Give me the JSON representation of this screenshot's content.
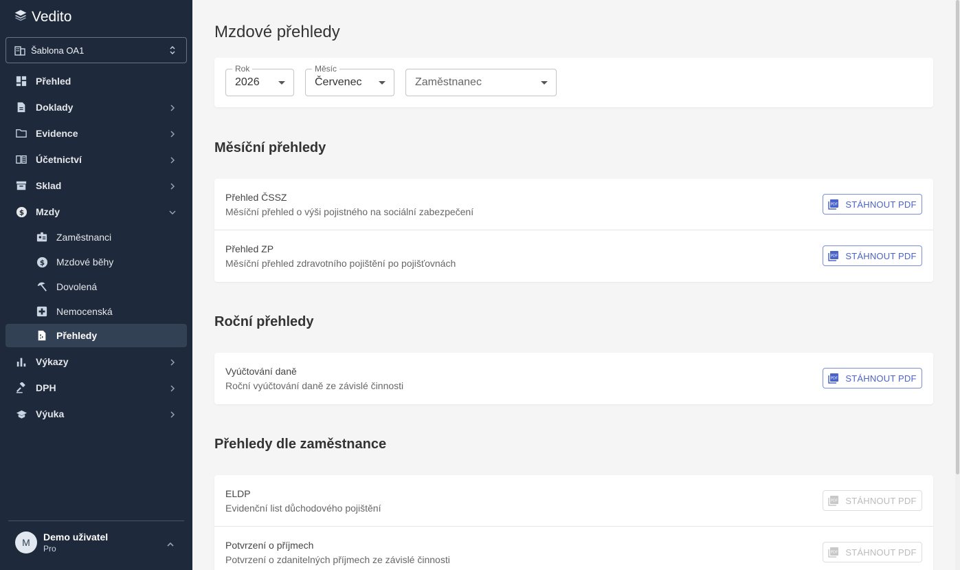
{
  "app": {
    "name": "Vedito"
  },
  "sidebar": {
    "org_select": {
      "value": "Šablona OA1"
    },
    "nav": [
      {
        "label": "Přehled",
        "icon": "dashboard-icon"
      },
      {
        "label": "Doklady",
        "icon": "document-icon"
      },
      {
        "label": "Evidence",
        "icon": "folder-icon"
      },
      {
        "label": "Účetnictví",
        "icon": "book-icon"
      },
      {
        "label": "Sklad",
        "icon": "archive-icon"
      },
      {
        "label": "Mzdy",
        "icon": "dollar-icon",
        "expanded": true
      },
      {
        "label": "Výkazy",
        "icon": "bar-chart-icon"
      },
      {
        "label": "DPH",
        "icon": "gavel-icon"
      },
      {
        "label": "Výuka",
        "icon": "school-icon"
      }
    ],
    "mzdy_sub": [
      {
        "label": "Zaměstnanci",
        "icon": "badge-icon"
      },
      {
        "label": "Mzdové běhy",
        "icon": "dollar-icon"
      },
      {
        "label": "Dovolená",
        "icon": "beach-icon"
      },
      {
        "label": "Nemocenská",
        "icon": "medical-icon"
      },
      {
        "label": "Přehledy",
        "icon": "report-icon",
        "active": true
      }
    ],
    "user": {
      "initial": "M",
      "name": "Demo uživatel",
      "plan": "Pro"
    }
  },
  "main": {
    "title": "Mzdové přehledy",
    "filters": {
      "year": {
        "label": "Rok",
        "value": "2026"
      },
      "month": {
        "label": "Měsíc",
        "value": "Červenec"
      },
      "employee": {
        "placeholder": "Zaměstnanec"
      }
    },
    "sections": [
      {
        "title": "Měsíční přehledy",
        "rows": [
          {
            "title": "Přehled ČSSZ",
            "desc": "Měsíční přehled o výši pojistného na sociální zabezpečení",
            "button": "STÁHNOUT PDF",
            "enabled": true
          },
          {
            "title": "Přehled ZP",
            "desc": "Měsíční přehled zdravotního pojištění po pojišťovnách",
            "button": "STÁHNOUT PDF",
            "enabled": true
          }
        ]
      },
      {
        "title": "Roční přehledy",
        "rows": [
          {
            "title": "Vyúčtování daně",
            "desc": "Roční vyúčtování daně ze závislé činnosti",
            "button": "STÁHNOUT PDF",
            "enabled": true
          }
        ]
      },
      {
        "title": "Přehledy dle zaměstnance",
        "rows": [
          {
            "title": "ELDP",
            "desc": "Evidenční list důchodového pojištění",
            "button": "STÁHNOUT PDF",
            "enabled": false
          },
          {
            "title": "Potvrzení o příjmech",
            "desc": "Potvrzení o zdanitelných příjmech ze závislé činnosti",
            "button": "STÁHNOUT PDF",
            "enabled": false
          }
        ]
      }
    ]
  },
  "colors": {
    "sidebar_bg": "#1e293b",
    "accent": "#4a63c8",
    "active_bg": "#334155"
  }
}
